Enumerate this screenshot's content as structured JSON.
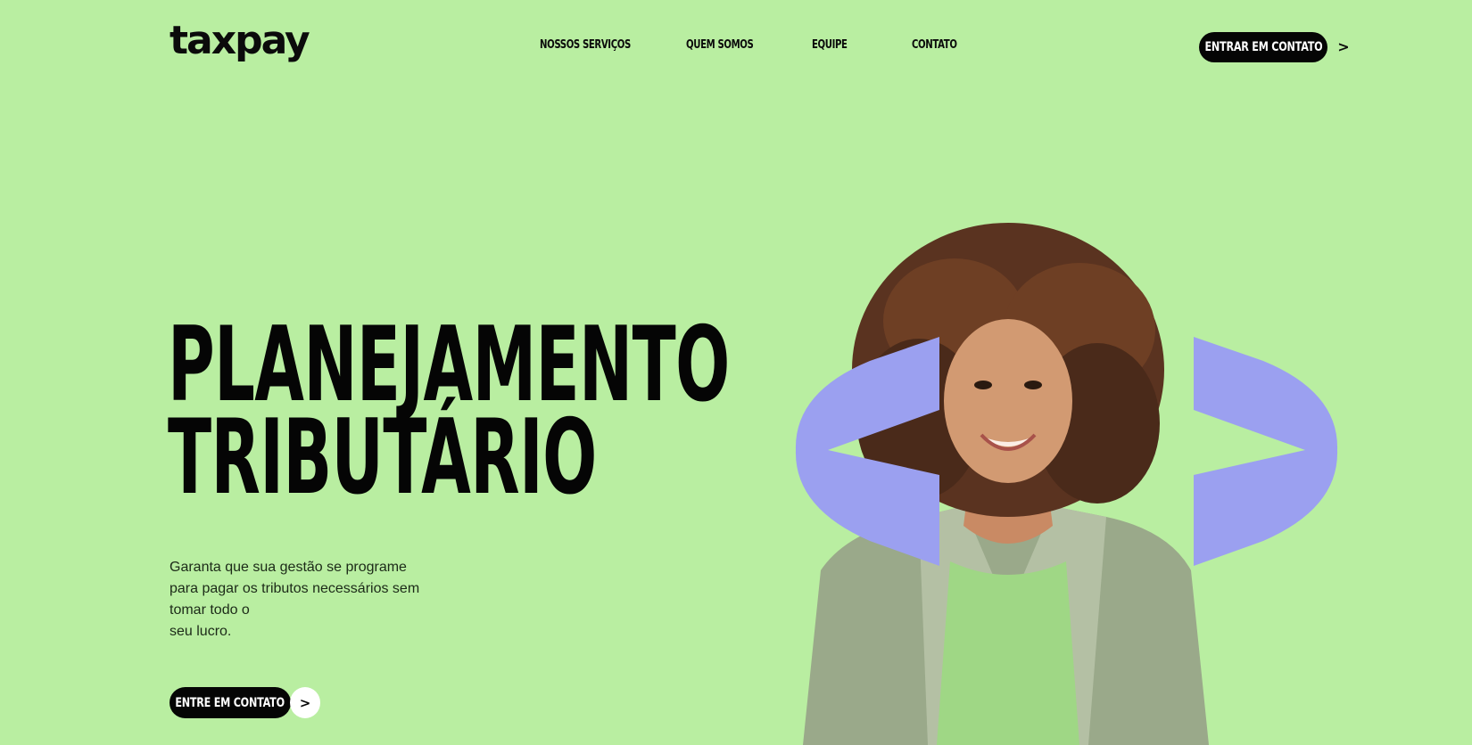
{
  "brand": {
    "logo_text": "taxpay"
  },
  "nav": {
    "items": [
      {
        "label": "NOSSOS SERVIÇOS"
      },
      {
        "label": "QUEM SOMOS"
      },
      {
        "label": "EQUIPE"
      },
      {
        "label": "CONTATO"
      }
    ],
    "cta_label": "ENTRAR EM CONTATO",
    "cta_arrow": ">"
  },
  "hero": {
    "title_line1": "PLANEJAMENTO",
    "title_line2": "TRIBUTÁRIO",
    "subtitle_lines": [
      "Garanta que sua gestão se programe",
      "para pagar os tributos necessários sem",
      "tomar todo o",
      "seu lucro."
    ],
    "cta_label": "ENTRE EM CONTATO",
    "cta_arrow": ">"
  },
  "colors": {
    "background": "#b9eea1",
    "text": "#050505",
    "button_bg": "#050505",
    "button_text": "#ffffff",
    "accent_shape": "#9ba0f0",
    "jacket": "#9aa98a"
  },
  "icons": {
    "top_cta_arrow": "chevron-right-icon",
    "bottom_cta_arrow": "chevron-right-icon"
  }
}
